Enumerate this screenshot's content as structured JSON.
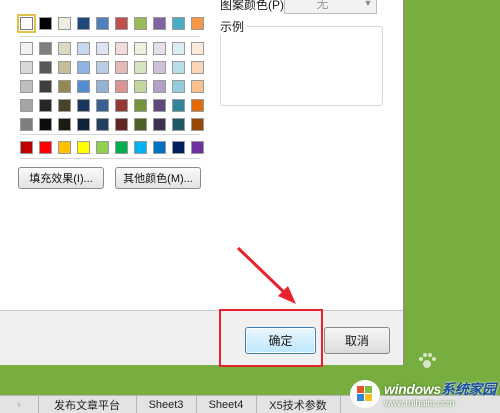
{
  "dialog": {
    "pattern_color_label": "图案颜色(P):",
    "pattern_color_value": "无",
    "sample_label": "示例",
    "fill_effects_label": "填充效果(I)...",
    "more_colors_label": "其他颜色(M)...",
    "ok_label": "确定",
    "cancel_label": "取消"
  },
  "palette": {
    "selected_index": 0,
    "theme_rows": [
      [
        "#ffffff",
        "#000000",
        "#eeece1",
        "#1f497d",
        "#4f81bd",
        "#c0504d",
        "#9bbb59",
        "#8064a2",
        "#4bacc6",
        "#f79646"
      ],
      [
        "#f2f2f2",
        "#7f7f7f",
        "#ddd9c3",
        "#c6d9f0",
        "#dbe5f1",
        "#f2dcdb",
        "#ebf1dd",
        "#e5e0ec",
        "#dbeef3",
        "#fdeada"
      ],
      [
        "#d8d8d8",
        "#595959",
        "#c4bd97",
        "#8db3e2",
        "#b8cce4",
        "#e5b9b7",
        "#d7e3bc",
        "#ccc1d9",
        "#b7dde8",
        "#fbd5b5"
      ],
      [
        "#bfbfbf",
        "#3f3f3f",
        "#938953",
        "#548dd4",
        "#95b3d7",
        "#d99694",
        "#c3d69b",
        "#b2a2c7",
        "#92cddc",
        "#fac08f"
      ],
      [
        "#a5a5a5",
        "#262626",
        "#494429",
        "#17365d",
        "#366092",
        "#953734",
        "#76923c",
        "#5f497a",
        "#31859b",
        "#e36c09"
      ],
      [
        "#7f7f7f",
        "#0c0c0c",
        "#1d1b10",
        "#0f243e",
        "#244061",
        "#632423",
        "#4f6128",
        "#3f3151",
        "#205867",
        "#974806"
      ]
    ],
    "standard_row": [
      "#c00000",
      "#ff0000",
      "#ffc000",
      "#ffff00",
      "#92d050",
      "#00b050",
      "#00b0f0",
      "#0070c0",
      "#002060",
      "#7030a0"
    ]
  },
  "sheet_tabs": [
    "发布文章平台",
    "Sheet3",
    "Sheet4",
    "X5技术参数"
  ],
  "watermark": {
    "brand_prefix": "windows",
    "brand_accent": "系统家园",
    "url": "www.ruihaitu.com"
  },
  "colors": {
    "background_green": "#78ad40",
    "highlight_red": "#e8222c"
  }
}
